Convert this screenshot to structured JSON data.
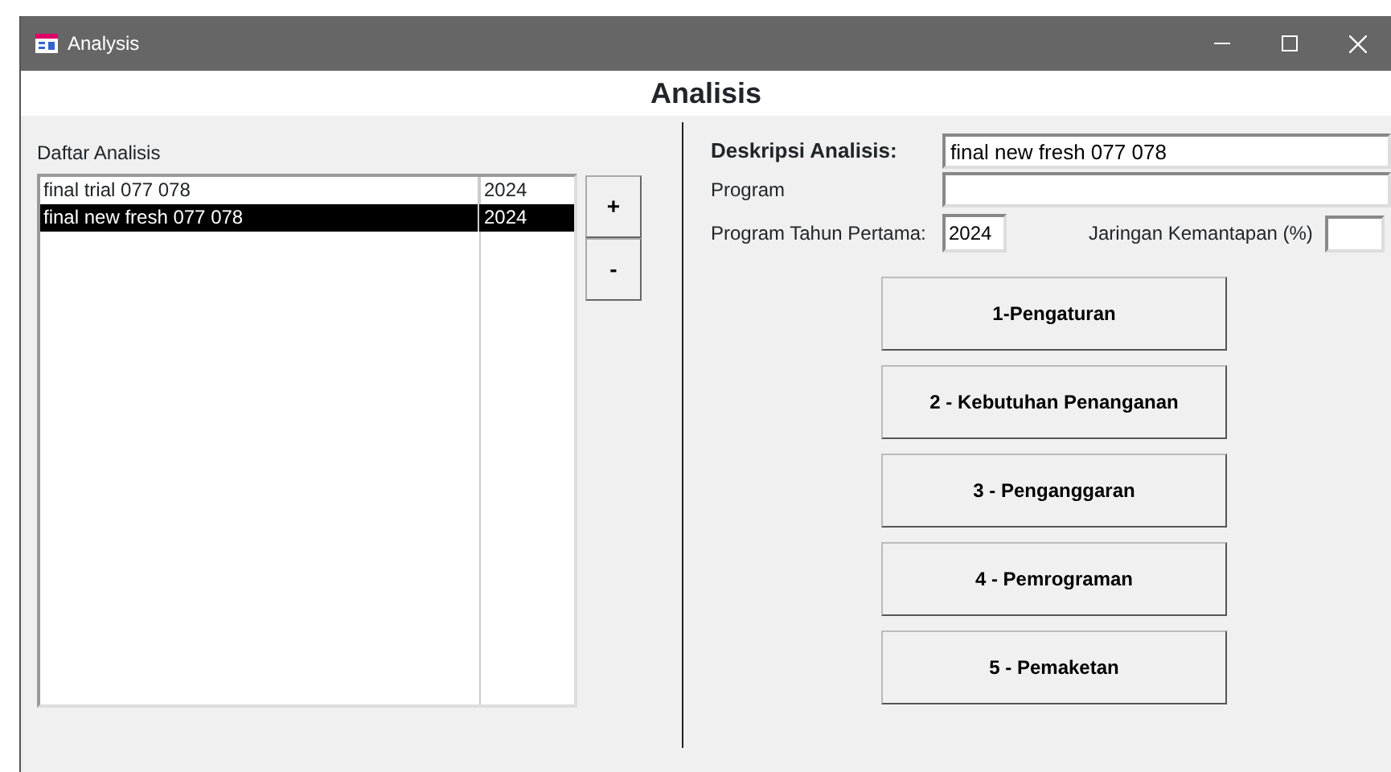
{
  "window": {
    "title": "Analysis"
  },
  "header": {
    "title": "Analisis"
  },
  "list": {
    "label": "Daftar Analisis",
    "rows": [
      {
        "name": "final trial 077 078",
        "year": "2024",
        "selected": false
      },
      {
        "name": "final new fresh 077 078",
        "year": "2024",
        "selected": true
      }
    ],
    "add_button": "+",
    "remove_button": "-"
  },
  "form": {
    "description_label": "Deskripsi Analisis:",
    "description_value": "final new fresh 077 078",
    "program_label": "Program",
    "first_year_label": "Program Tahun Pertama:",
    "first_year_value": "2024",
    "stability_label": "Jaringan Kemantapan (%)"
  },
  "steps": [
    "1-Pengaturan",
    "2 - Kebutuhan Penanganan",
    "3 - Penganggaran",
    "4 - Pemrograman",
    "5 - Pemaketan"
  ]
}
